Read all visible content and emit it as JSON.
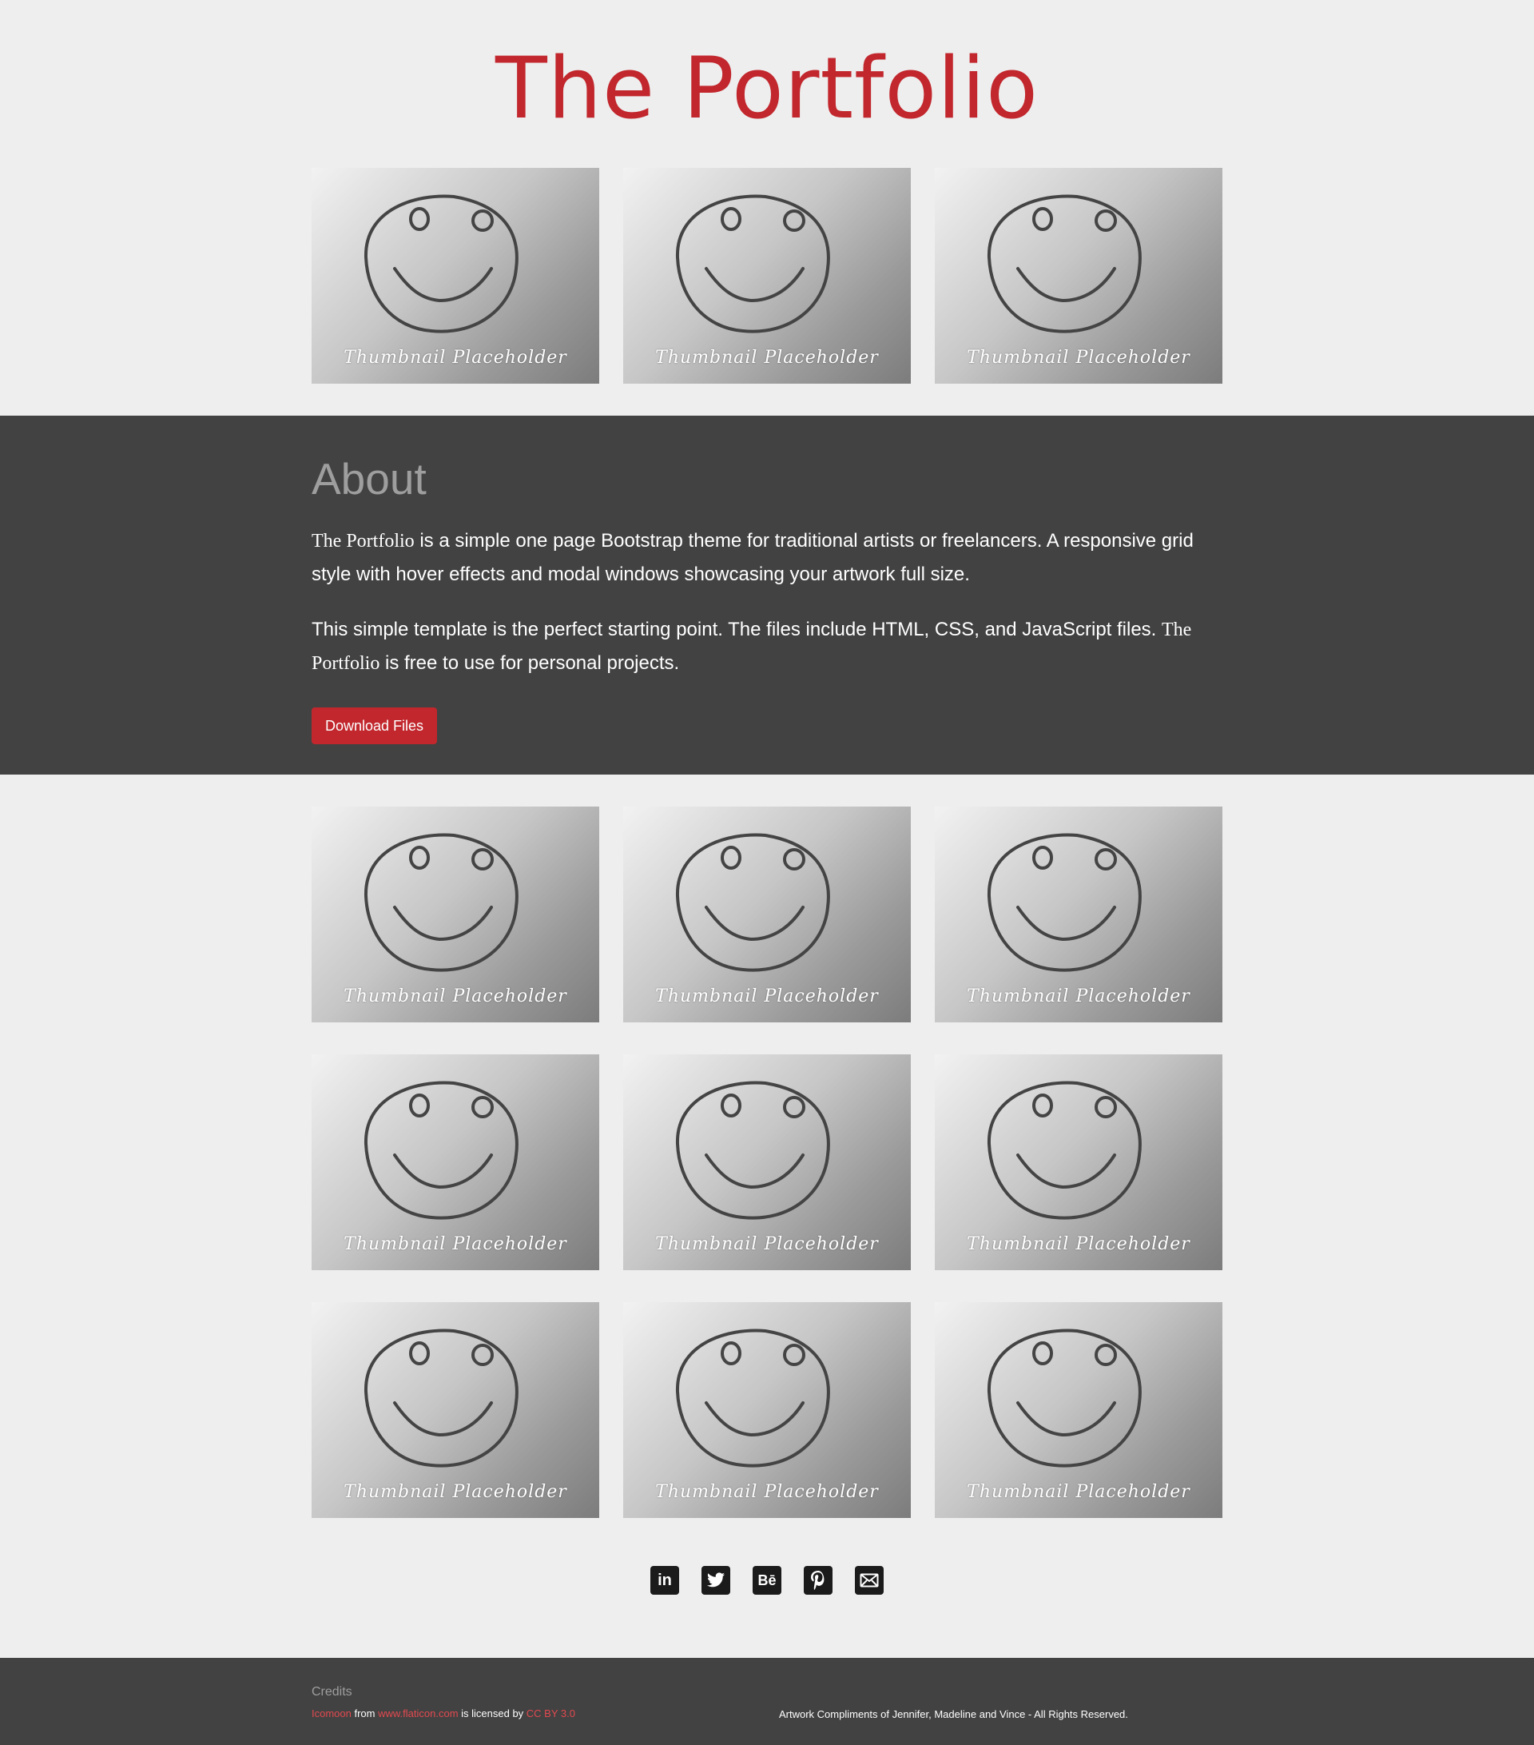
{
  "header": {
    "title": "The Portfolio"
  },
  "thumbnail": {
    "caption": "Thumbnail Placeholder"
  },
  "top_thumbnails": [
    {
      "caption": "Thumbnail Placeholder"
    },
    {
      "caption": "Thumbnail Placeholder"
    },
    {
      "caption": "Thumbnail Placeholder"
    }
  ],
  "about": {
    "heading": "About",
    "paragraph1": {
      "brand": "The Portfolio",
      "text": " is a simple one page Bootstrap theme for traditional artists or freelancers. A responsive grid style with hover effects and modal windows showcasing your artwork full size."
    },
    "paragraph2": {
      "text_a": "This simple template is the perfect starting point. The files include HTML, CSS, and JavaScript files. ",
      "brand": "The Portfolio",
      "text_b": " is free to use for personal projects."
    },
    "button_label": "Download Files"
  },
  "gallery_rows": [
    [
      "Thumbnail Placeholder",
      "Thumbnail Placeholder",
      "Thumbnail Placeholder"
    ],
    [
      "Thumbnail Placeholder",
      "Thumbnail Placeholder",
      "Thumbnail Placeholder"
    ],
    [
      "Thumbnail Placeholder",
      "Thumbnail Placeholder",
      "Thumbnail Placeholder"
    ]
  ],
  "social": [
    {
      "icon": "linkedin-icon",
      "glyph": "in"
    },
    {
      "icon": "twitter-icon"
    },
    {
      "icon": "behance-icon",
      "glyph": "Bē"
    },
    {
      "icon": "pinterest-icon"
    },
    {
      "icon": "mail-icon"
    }
  ],
  "footer": {
    "credits_heading": "Credits",
    "icon_source": "Icomoon",
    "from_text": " from ",
    "site_link": "www.flaticon.com",
    "licensed_text": " is licensed by ",
    "license_link": "CC BY 3.0",
    "rights": "Artwork Compliments of Jennifer, Madeline and Vince - All Rights Reserved."
  },
  "colors": {
    "accent": "#c1272d",
    "dark_section": "#424242",
    "page_background": "#eeeeee",
    "muted_heading": "#9e9e9e",
    "link": "#e2494f"
  }
}
